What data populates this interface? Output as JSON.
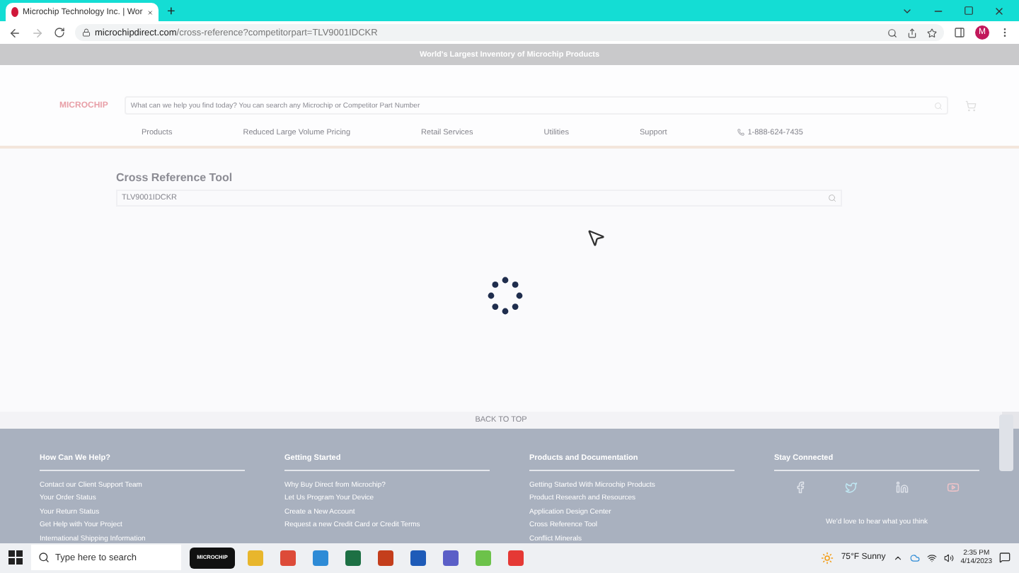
{
  "browser": {
    "tab_title": "Microchip Technology Inc. | Wor",
    "new_tab": "+",
    "url_domain": "microchipdirect.com",
    "url_path": "/cross-reference?competitorpart=TLV9001IDCKR",
    "profile_initial": "M"
  },
  "banner": "World's Largest Inventory of Microchip Products",
  "header": {
    "logo": "MICROCHIP",
    "search_placeholder": "What can we help you find today? You can search any Microchip or Competitor Part Number",
    "nav": [
      "Products",
      "Reduced Large Volume Pricing",
      "Retail Services",
      "Utilities",
      "Support",
      "1-888-624-7435"
    ]
  },
  "tool": {
    "title": "Cross Reference Tool",
    "value": "TLV9001IDCKR"
  },
  "back_to_top": "BACK TO TOP",
  "footer": {
    "columns": [
      {
        "heading": "How Can We Help?",
        "links": [
          "Contact our Client Support Team",
          "Your Order Status",
          "Your Return Status",
          "Get Help with Your Project",
          "International Shipping Information"
        ]
      },
      {
        "heading": "Getting Started",
        "links": [
          "Why Buy Direct from Microchip?",
          "Let Us Program Your Device",
          "Create a New Account",
          "Request a new Credit Card or Credit Terms"
        ]
      },
      {
        "heading": "Products and Documentation",
        "links": [
          "Getting Started With Microchip Products",
          "Product Research and Resources",
          "Application Design Center",
          "Cross Reference Tool",
          "Conflict Minerals"
        ]
      }
    ],
    "social_heading": "Stay Connected",
    "feedback": "We'd love to hear what you think"
  },
  "taskbar": {
    "search_placeholder": "Type here to search",
    "pinned_app": "MICROCHIP",
    "weather": "75°F Sunny",
    "time": "2:35 PM",
    "date": "4/14/2023"
  }
}
